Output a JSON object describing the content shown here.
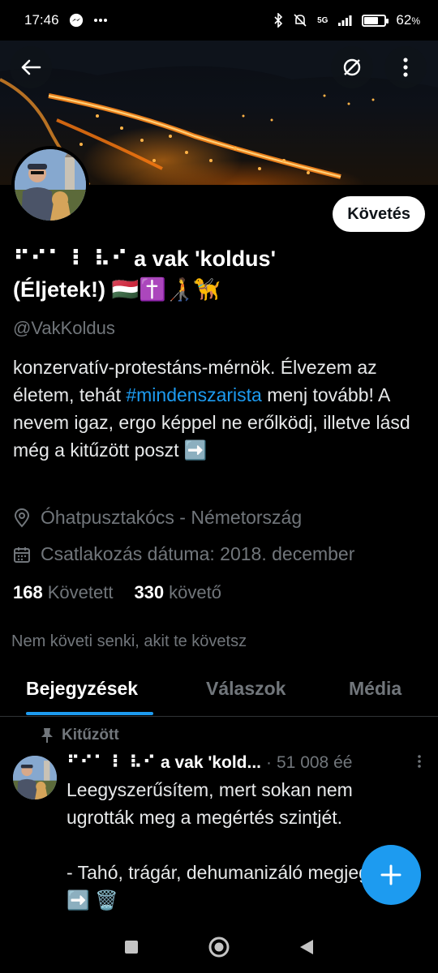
{
  "status_bar": {
    "time": "17:46",
    "network": "5G",
    "battery_text": "62",
    "battery_unit": "%",
    "battery_level": 0.62
  },
  "header": {
    "back_icon": "arrow-left-icon",
    "filter_icon": "circle-slash-icon",
    "more_icon": "vertical-dots-icon"
  },
  "profile": {
    "name_line1": "⠋⠊⠁ ⠇ ⠧⠊ a vak 'koldus'",
    "name_line2": "(Éljetek!) 🇭🇺✝️🧑‍🦯🦮",
    "handle": "@VakKoldus",
    "follow_label": "Követés",
    "bio_part1": "konzervatív-protestáns-mérnök. Élvezem az életem, tehát ",
    "bio_hashtag": "#mindenszarista",
    "bio_part2": " menj tovább! A nevem igaz, ergo képpel ne erőlködj, illetve lásd még a kitűzött poszt ➡️",
    "location": "Óhatpusztakócs - Németország",
    "joined": "Csatlakozás dátuma: 2018. december",
    "following_count": "168",
    "following_label": "Követett",
    "followers_count": "330",
    "followers_label": "követő",
    "mutuals_notice": "Nem követi senki, akit te követsz"
  },
  "tabs": [
    {
      "label": "Bejegyzések",
      "active": true
    },
    {
      "label": "Válaszok",
      "active": false
    },
    {
      "label": "Média",
      "active": false
    }
  ],
  "pinned_post": {
    "pinned_label": "Kitűzött",
    "author": "⠋⠊⠁ ⠇ ⠧⠊ a vak 'kold...",
    "separator": "·",
    "meta": "51 008 éé",
    "text": "Leegyszerűsítem, mert sokan nem ugrották meg a megértés szintjét.\n\n- Tahó, trágár, dehumanizáló megjegyzés ➡️ 🗑️"
  },
  "colors": {
    "accent": "#1d9bf0",
    "muted": "#71767b",
    "text": "#e7e9ea",
    "background": "#000000"
  }
}
